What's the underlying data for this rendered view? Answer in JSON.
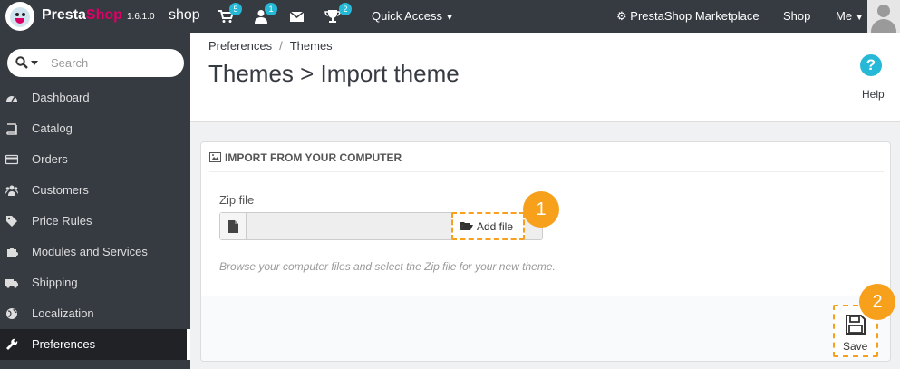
{
  "topbar": {
    "brand_presta": "Presta",
    "brand_shop": "Shop",
    "version": "1.6.1.0",
    "shop_name": "shop",
    "cart_badge": "5",
    "user_badge": "1",
    "trophy_badge": "2",
    "quick_access": "Quick Access",
    "marketplace": "PrestaShop Marketplace",
    "shop_link": "Shop",
    "me": "Me"
  },
  "search": {
    "placeholder": "Search"
  },
  "sidebar": {
    "items": [
      {
        "label": "Dashboard",
        "icon": "dashboard-icon"
      },
      {
        "label": "Catalog",
        "icon": "book-icon"
      },
      {
        "label": "Orders",
        "icon": "credit-card-icon"
      },
      {
        "label": "Customers",
        "icon": "users-icon"
      },
      {
        "label": "Price Rules",
        "icon": "tags-icon"
      },
      {
        "label": "Modules and Services",
        "icon": "puzzle-icon"
      },
      {
        "label": "Shipping",
        "icon": "truck-icon"
      },
      {
        "label": "Localization",
        "icon": "globe-icon"
      },
      {
        "label": "Preferences",
        "icon": "wrench-icon"
      }
    ]
  },
  "header": {
    "breadcrumb_1": "Preferences",
    "breadcrumb_sep": "/",
    "breadcrumb_2": "Themes",
    "title": "Themes > Import theme",
    "help_icon_text": "?",
    "help_label": "Help"
  },
  "panel": {
    "heading": "Import from your computer",
    "zip_label": "Zip file",
    "add_file": "Add file",
    "hint": "Browse your computer files and select the Zip file for your new theme.",
    "save": "Save"
  },
  "markers": {
    "one": "1",
    "two": "2"
  },
  "colors": {
    "topbar": "#363a41",
    "accent": "#25b9d7",
    "brand_pink": "#df0067",
    "highlight": "#f7a01c"
  }
}
